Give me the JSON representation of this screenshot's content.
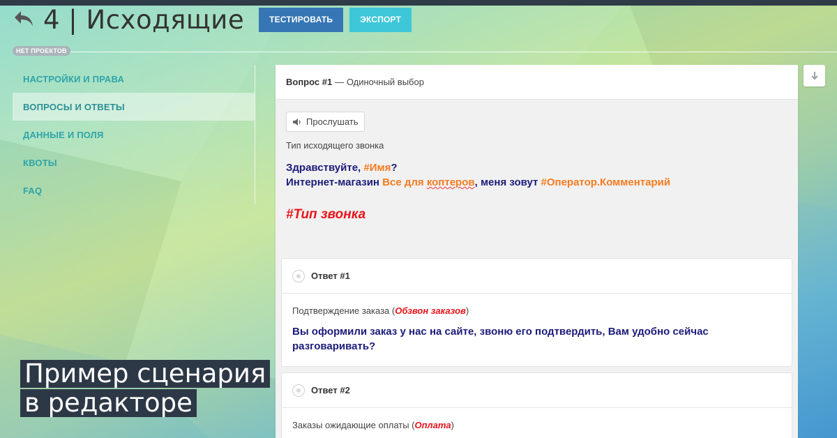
{
  "header": {
    "title": "4 | Исходящие",
    "test_button": "ТЕСТИРОВАТЬ",
    "export_button": "ЭКСПОРТ"
  },
  "projects_badge": "НЕТ ПРОЕКТОВ",
  "sidebar": {
    "items": [
      {
        "label": "НАСТРОЙКИ И ПРАВА",
        "active": false
      },
      {
        "label": "ВОПРОСЫ И ОТВЕТЫ",
        "active": true
      },
      {
        "label": "ДАННЫЕ И ПОЛЯ",
        "active": false
      },
      {
        "label": "КВОТЫ",
        "active": false
      },
      {
        "label": "FAQ",
        "active": false
      }
    ]
  },
  "question": {
    "number_label": "Вопрос #1",
    "type_label": "— Одиночный выбор",
    "listen_button": "Прослушать",
    "call_type_label": "Тип исходящего звонка",
    "greeting": "Здравствуйте,",
    "greeting_var": "#Имя",
    "greeting_end": "?",
    "intro_start": "Интернет-магазин",
    "shop_name_a": "Все для ",
    "shop_name_b": "коптеров",
    "intro_mid": ", меня зовут",
    "operator_var": "#Оператор.Комментарий",
    "call_tag": "#Тип звонка"
  },
  "answers": [
    {
      "label": "Ответ #1",
      "sub_text": "Подтверждение заказа (",
      "sub_tag": "Обзвон заказов",
      "sub_end": ")",
      "text": "Вы оформили заказ у нас на сайте, звоню его подтвердить, Вам удобно сейчас разговаривать?"
    },
    {
      "label": "Ответ #2",
      "sub_text": "Заказы ожидающие оплаты (",
      "sub_tag": "Оплата",
      "sub_end": ")"
    }
  ],
  "caption": {
    "line1": "Пример сценария",
    "line2": "в редакторе"
  },
  "icons": {
    "back": "back-arrow-icon",
    "speaker": "speaker-icon",
    "download": "arrow-down-icon"
  },
  "colors": {
    "test_button": "#3676b5",
    "export_button": "#3ec7d9",
    "nav_text": "#2fa4a9",
    "script_text": "#1c1b7a",
    "variable": "#f47b20",
    "tag": "#e8141b"
  }
}
